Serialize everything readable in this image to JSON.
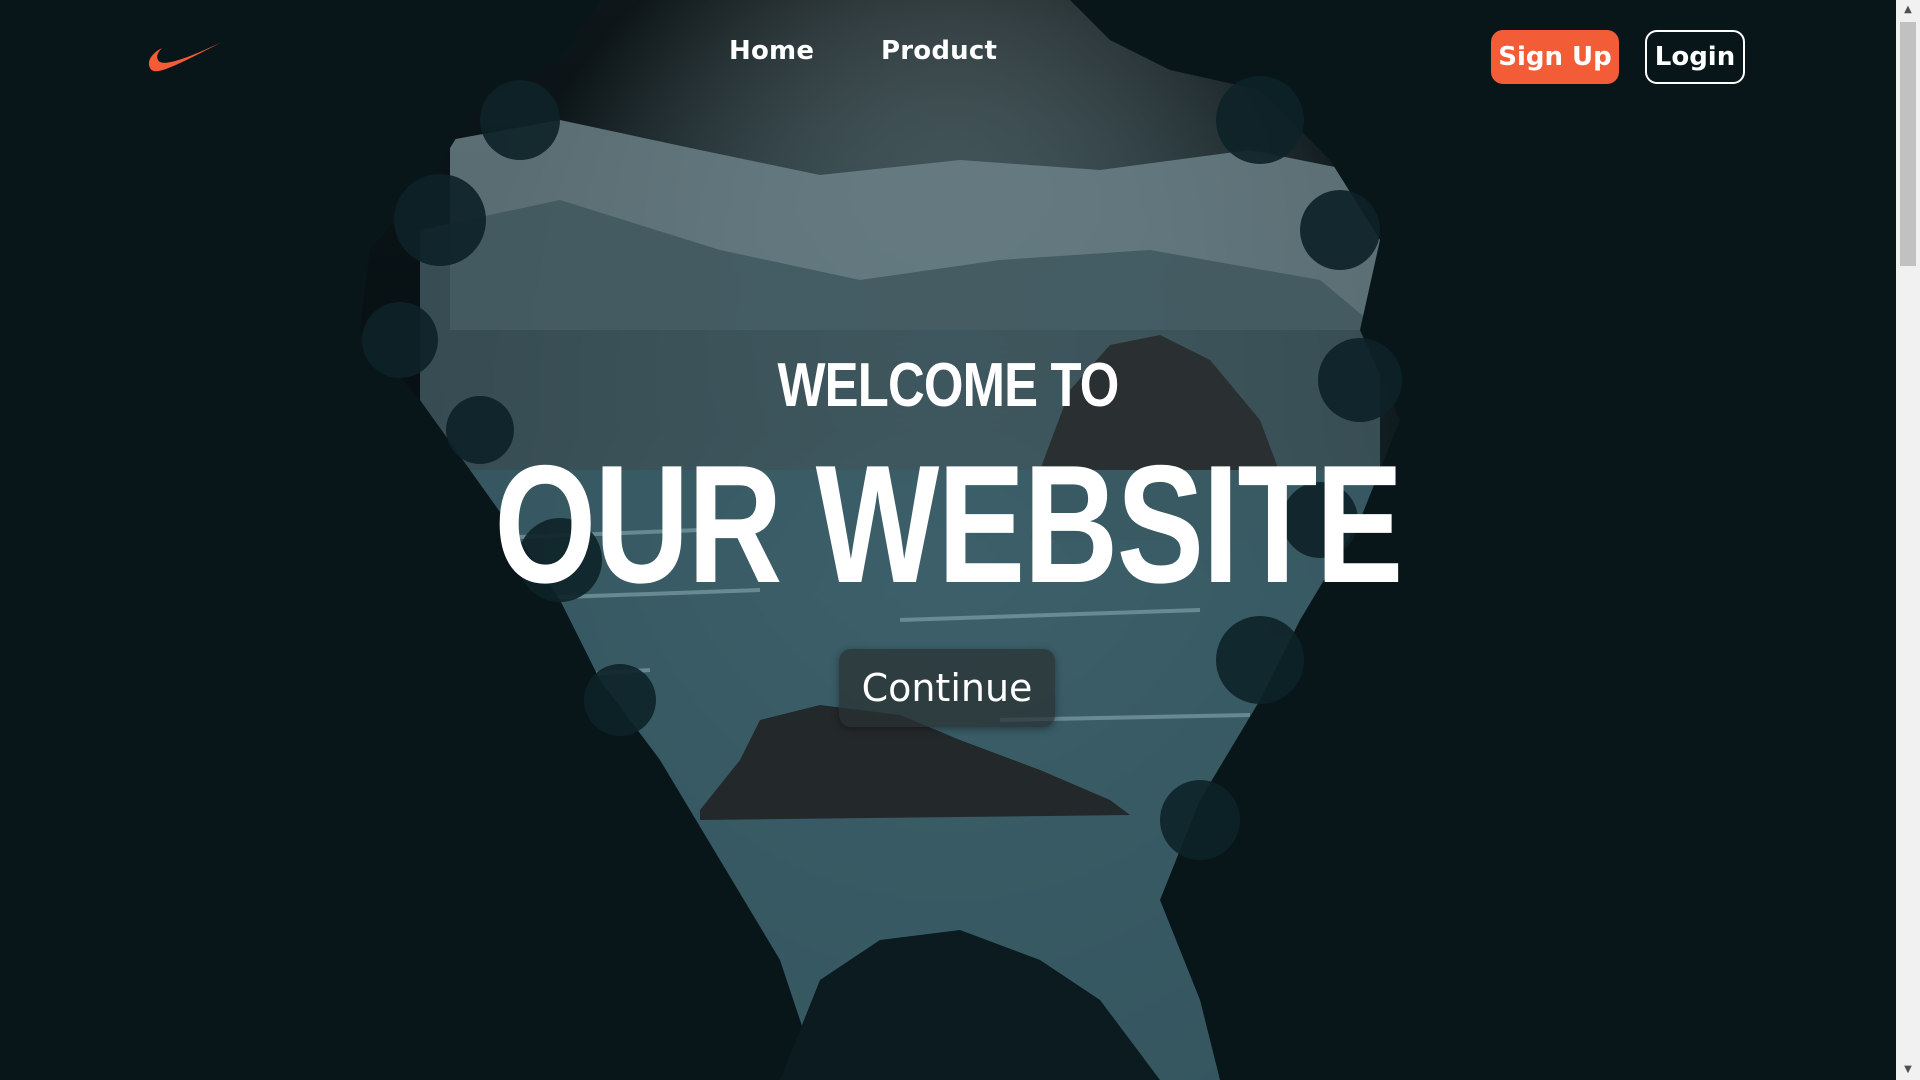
{
  "nav": {
    "logo": "swoosh-logo",
    "links": [
      {
        "label": "Home"
      },
      {
        "label": "Product"
      }
    ],
    "signup_label": "Sign Up",
    "login_label": "Login"
  },
  "hero": {
    "kicker": "WELCOME TO",
    "headline": "OUR WEBSITE",
    "cta_label": "Continue",
    "background": "coastal-forest-photo"
  },
  "colors": {
    "accent": "#f25c37",
    "text": "#ffffff",
    "cta_bg": "#283032"
  },
  "scrollbar": {
    "up_icon": "scroll-up-arrow-icon",
    "down_icon": "scroll-down-arrow-icon"
  }
}
